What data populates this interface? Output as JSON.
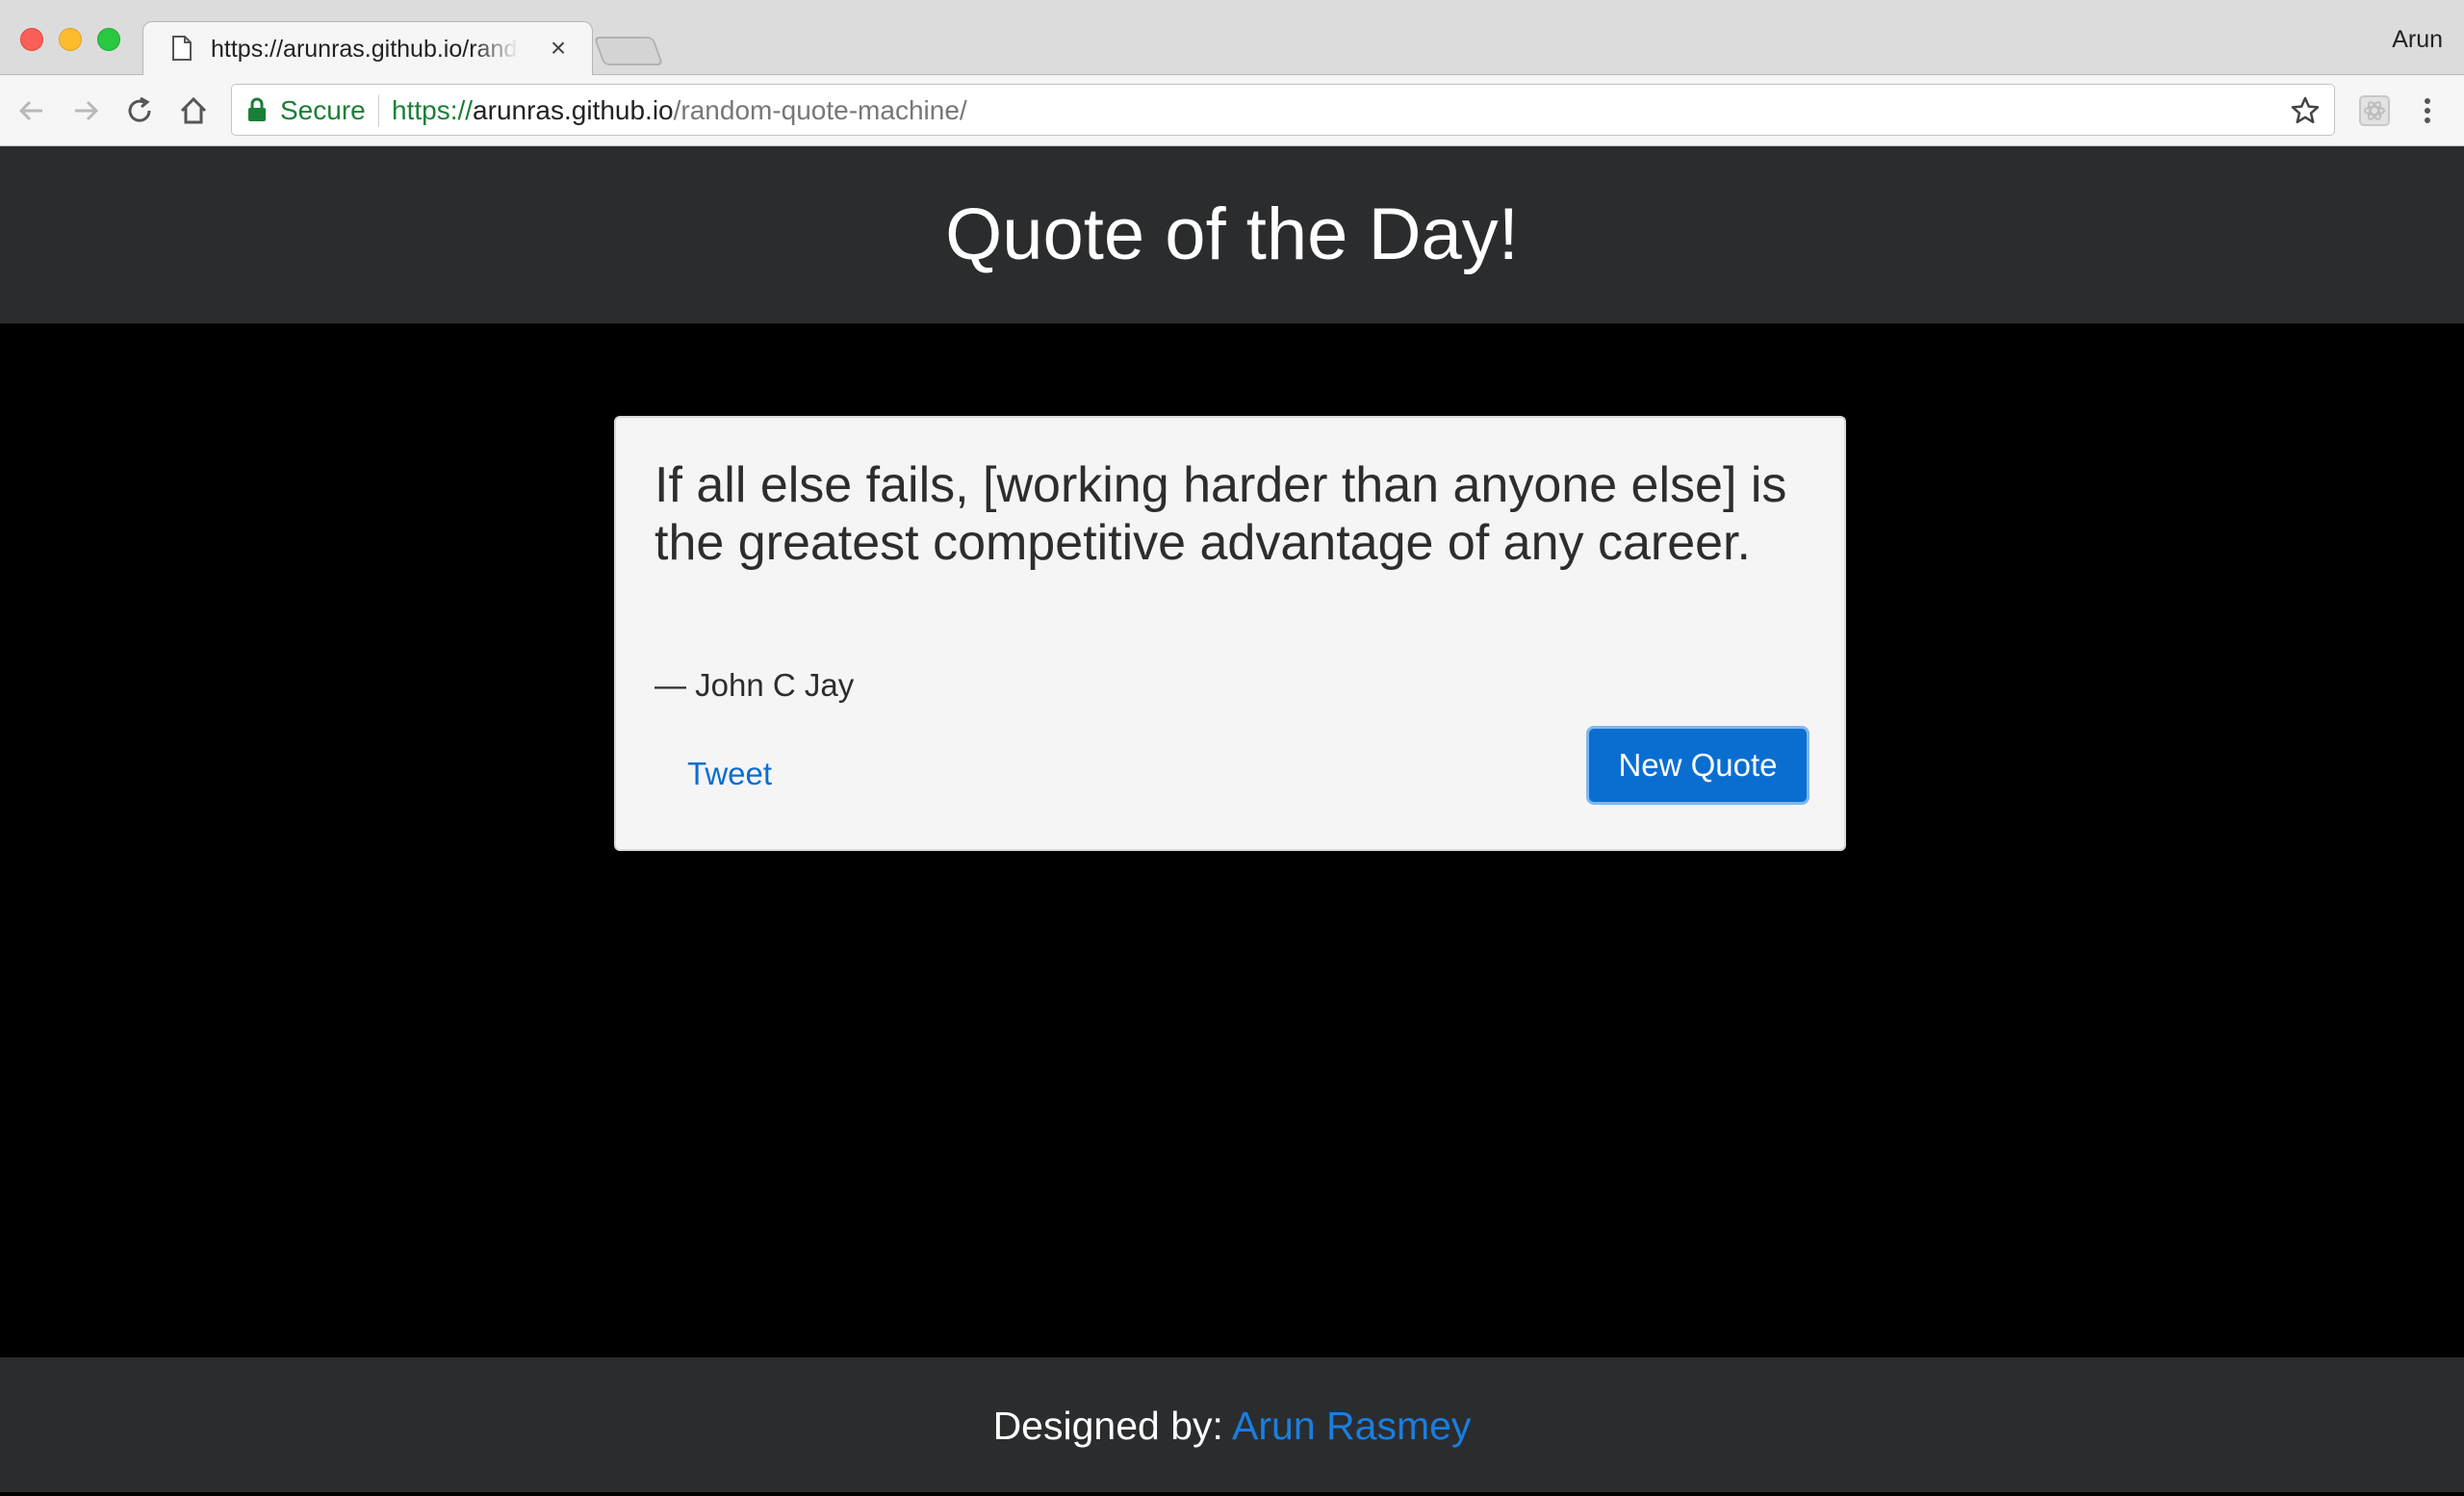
{
  "browser": {
    "tab_title": "https://arunras.github.io/random-quote-machine/",
    "profile_name": "Arun",
    "secure_label": "Secure",
    "url": {
      "scheme": "https://",
      "host": "arunras.github.io",
      "path": "/random-quote-machine/"
    },
    "icons": [
      "back-icon",
      "forward-icon",
      "reload-icon",
      "home-icon",
      "lock-icon",
      "star-icon",
      "extension-icon",
      "menu-icon",
      "page-icon",
      "close-icon"
    ]
  },
  "header": {
    "title": "Quote of the Day!"
  },
  "quote": {
    "text": "If all else fails, [working harder than anyone else] is the greatest competitive advantage of any career.",
    "author": "— John C Jay",
    "tweet_label": "Tweet",
    "new_quote_label": "New Quote"
  },
  "footer": {
    "designed_by_label": "Designed by:",
    "author_name": "Arun Rasmey"
  },
  "colors": {
    "header_bg": "#2b2c2e",
    "page_bg": "#000000",
    "card_bg": "#f5f5f5",
    "accent": "#0a6ed1",
    "secure_green": "#1a7f37"
  }
}
